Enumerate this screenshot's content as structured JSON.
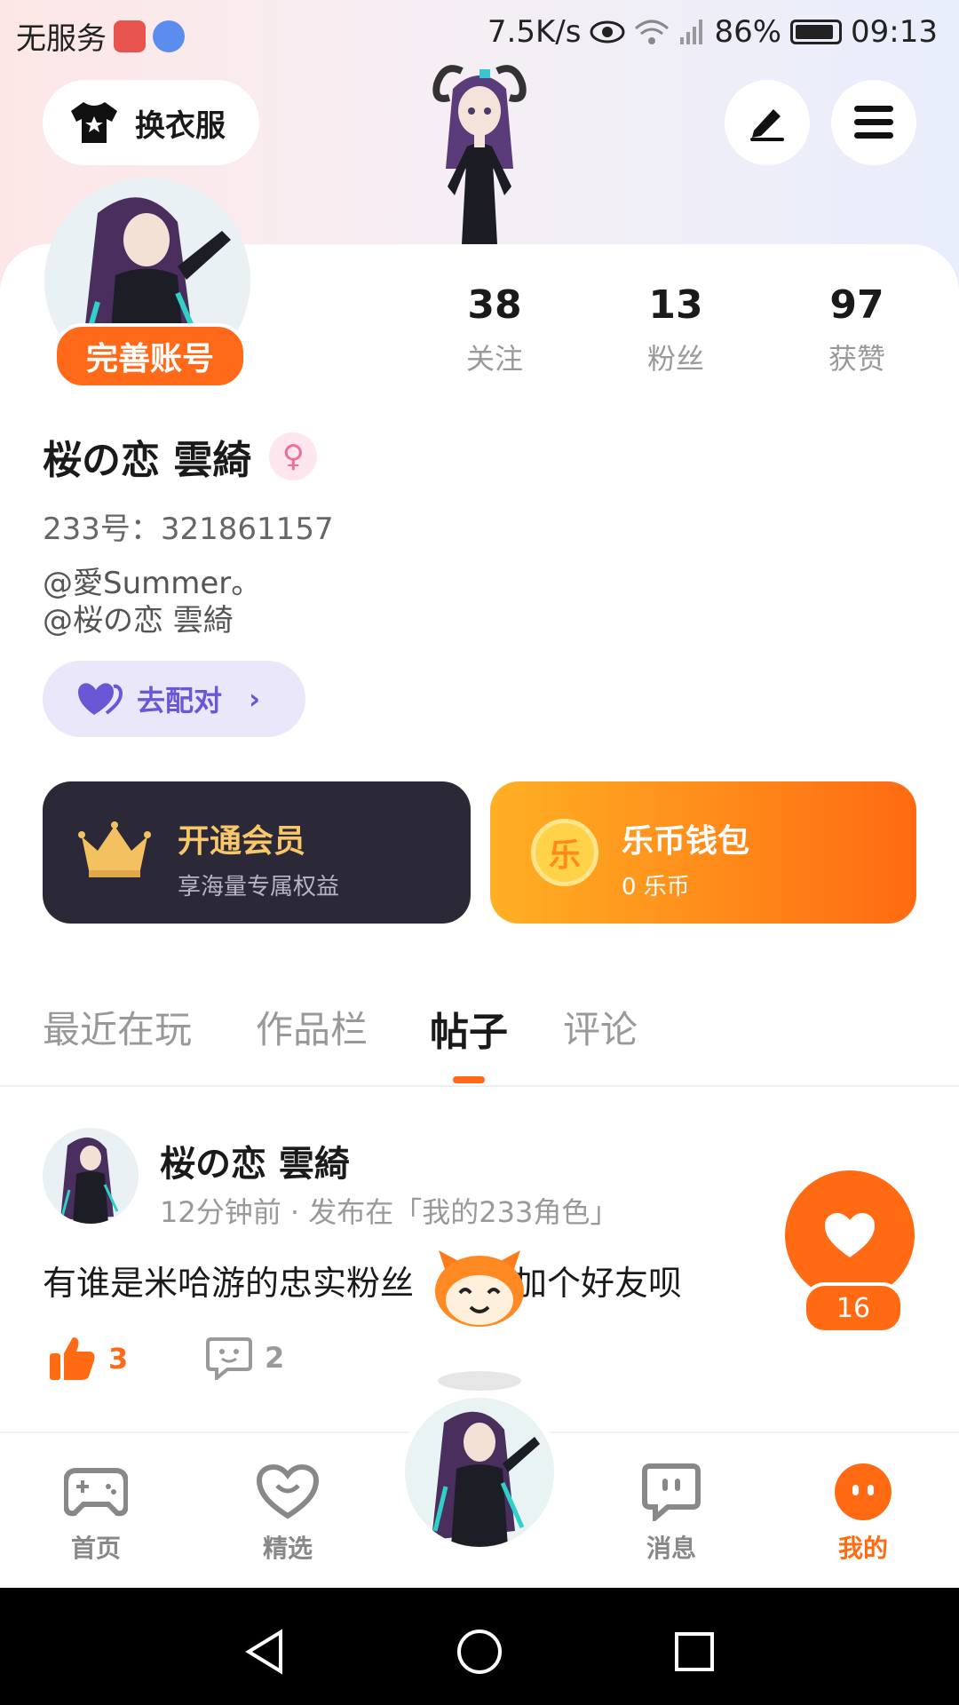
{
  "status_bar": {
    "carrier": "无服务",
    "speed": "7.5K/s",
    "battery": "86%",
    "time": "09:13"
  },
  "header": {
    "dress_label": "换衣服"
  },
  "profile": {
    "complete_label": "完善账号",
    "stats": [
      {
        "num": "38",
        "label": "关注"
      },
      {
        "num": "13",
        "label": "粉丝"
      },
      {
        "num": "97",
        "label": "获赞"
      }
    ],
    "name": "桜の恋 雲綺",
    "uid": "233号：321861157",
    "bio_line1": "@愛Summer。",
    "bio_line2": "@桜の恋 雲綺",
    "pair_label": "去配对"
  },
  "cards": {
    "vip_title": "开通会员",
    "vip_sub": "享海量专属权益",
    "coin_title": "乐币钱包",
    "coin_sub": "0 乐币",
    "coin_glyph": "乐"
  },
  "tabs": [
    "最近在玩",
    "作品栏",
    "帖子",
    "评论"
  ],
  "post": {
    "author": "桜の恋 雲綺",
    "meta": "12分钟前 · 发布在「我的233角色」",
    "text_before": "有谁是米哈游的忠实粉丝",
    "text_after": "加个好友呗",
    "likes": "3",
    "comments": "2",
    "heart_count": "16"
  },
  "bottom_nav": {
    "home": "首页",
    "featured": "精选",
    "messages": "消息",
    "mine": "我的"
  },
  "colors": {
    "accent": "#ff6a12",
    "vip_bg": "#2b2838",
    "vip_text": "#f7c76a",
    "pair_bg": "#ebe7fb",
    "pair_text": "#6a57d6"
  }
}
